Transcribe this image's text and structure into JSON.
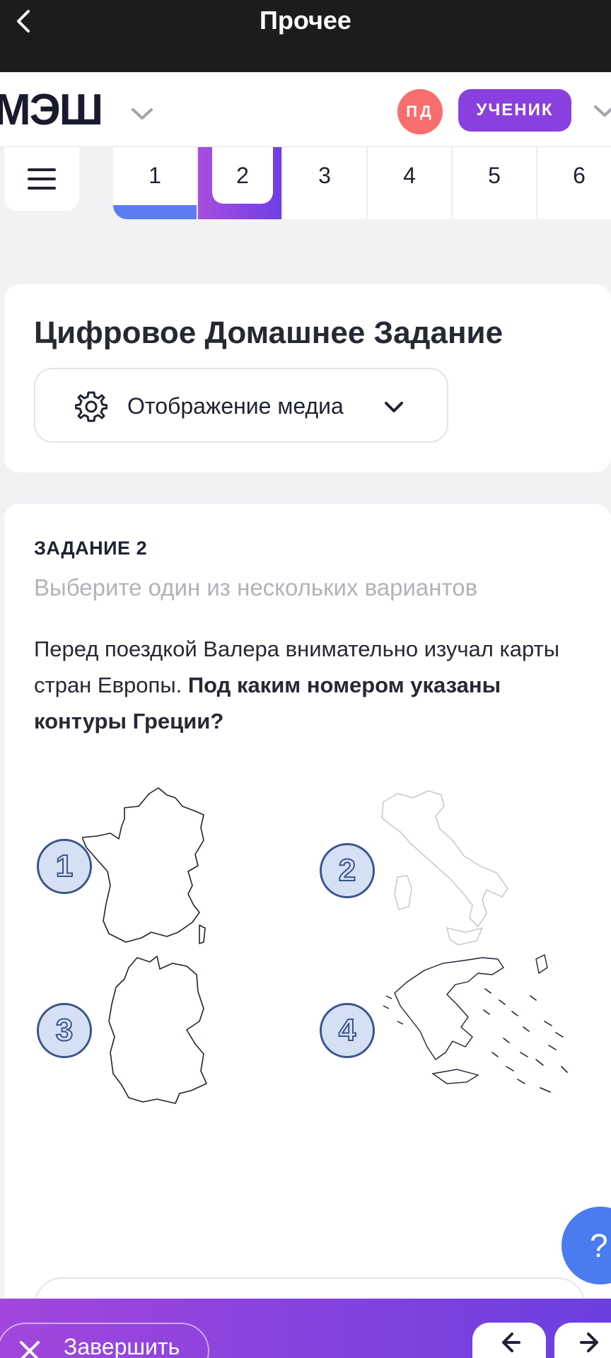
{
  "statusbar": {
    "title": "Прочее"
  },
  "appbar": {
    "logo": "МЭШ",
    "avatar_initials": "ПД",
    "role_label": "УЧЕНИК"
  },
  "tabs": [
    "1",
    "2",
    "3",
    "4",
    "5",
    "6"
  ],
  "header_card": {
    "title": "Цифровое Домашнее Задание",
    "media_label": "Отображение медиа"
  },
  "task": {
    "label": "ЗАДАНИЕ 2",
    "hint": "Выберите один из нескольких вариантов",
    "text_plain": "Перед поездкой Валера внимательно изучал карты стран Европы. ",
    "text_bold": "Под каким номером указаны контуры Греции?",
    "options": [
      "1",
      "2",
      "3",
      "4"
    ]
  },
  "help": {
    "label": "?"
  },
  "bottombar": {
    "finish_label": "Завершить"
  },
  "icons": [
    "back-chevron-icon",
    "chevron-down-icon",
    "menu-icon",
    "gear-icon",
    "close-icon",
    "arrow-left-icon",
    "arrow-right-icon"
  ],
  "colors": {
    "accent_purple": "#8a40e0",
    "accent_blue": "#5b7df0",
    "avatar_red": "#f86d6d"
  }
}
